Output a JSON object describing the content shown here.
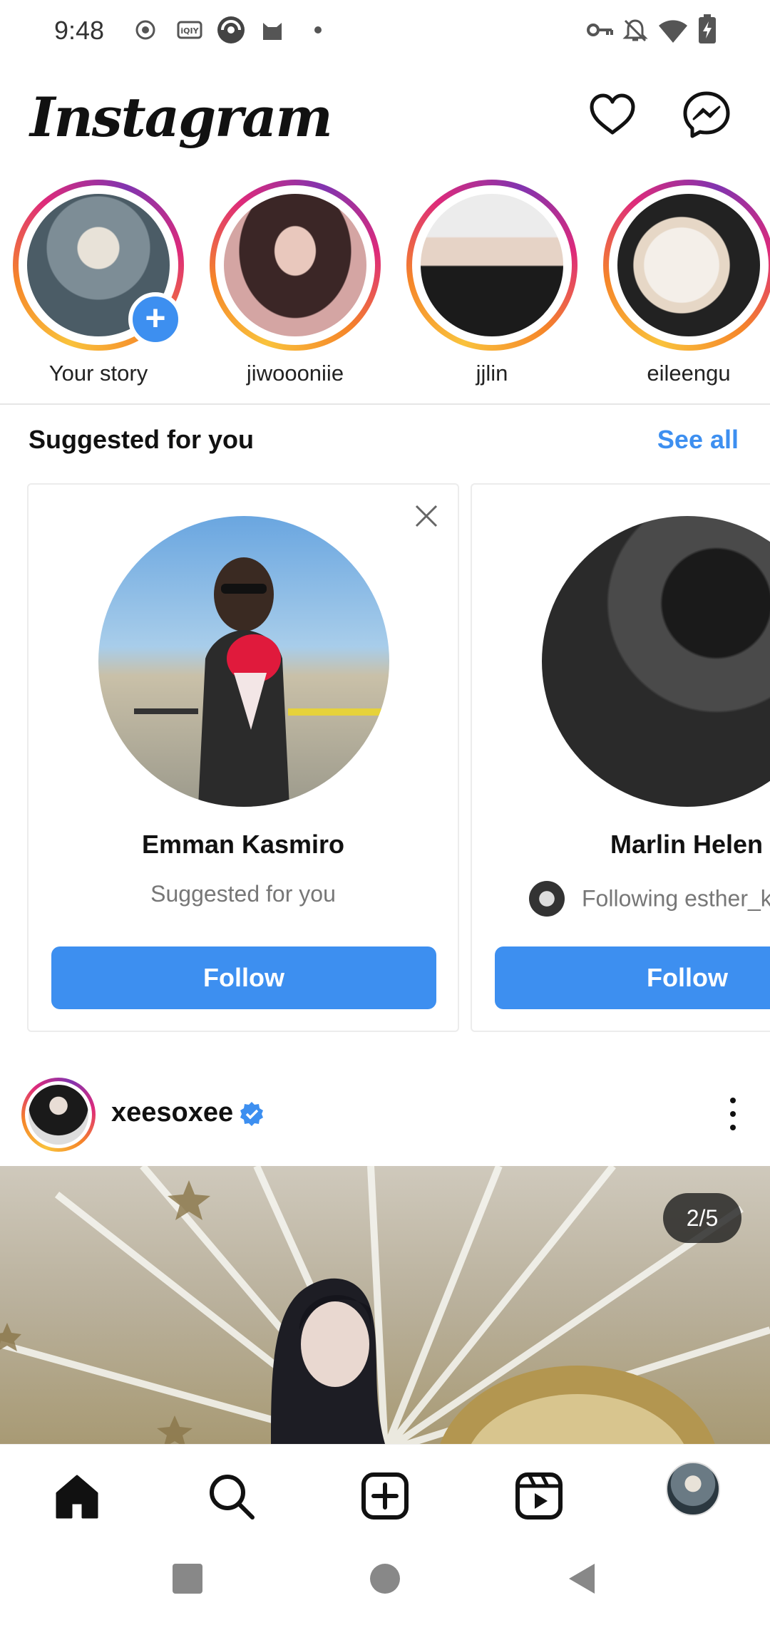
{
  "status_bar": {
    "time": "9:48",
    "left_icons": [
      "record-icon",
      "iqiyi-icon",
      "app-icon",
      "cat-icon",
      "dot-icon"
    ],
    "right_icons": [
      "vpn-key-icon",
      "bell-off-icon",
      "wifi-icon",
      "battery-charging-icon"
    ]
  },
  "header": {
    "logo": "Instagram",
    "icons": [
      "heart-icon",
      "messenger-icon"
    ]
  },
  "stories": [
    {
      "label": "Your story",
      "colors": [
        "#6d7f8a",
        "#b9c6cc"
      ],
      "own": true
    },
    {
      "label": "jiwoooniie",
      "colors": [
        "#d9a6a0",
        "#3a2a2a"
      ]
    },
    {
      "label": "jjlin",
      "colors": [
        "#e6e6e6",
        "#1a1a1a"
      ]
    },
    {
      "label": "eileengu",
      "colors": [
        "#2a2a2a",
        "#f2f2f2"
      ]
    }
  ],
  "suggested": {
    "title": "Suggested for you",
    "see_all": "See all",
    "cards": [
      {
        "name": "Emman Kasmiro",
        "subtitle": "Suggested for you",
        "follow": "Follow",
        "colors": [
          "#7fb2e5",
          "#2d2d2d"
        ]
      },
      {
        "name": "Marlin Helen",
        "subtitle": "Following esther_k",
        "follow": "Follow",
        "colors": [
          "#3a3a3a",
          "#0d0d0d"
        ]
      }
    ]
  },
  "post": {
    "username": "xeesoxee",
    "verified": true,
    "counter": "2/5"
  },
  "bottom_nav": [
    "home-icon",
    "search-icon",
    "create-icon",
    "reels-icon",
    "profile-avatar"
  ],
  "system_nav": [
    "recents-button",
    "home-button",
    "back-button"
  ],
  "colors": {
    "accent": "#3d8ff0",
    "text": "#111111",
    "muted": "#777777"
  }
}
